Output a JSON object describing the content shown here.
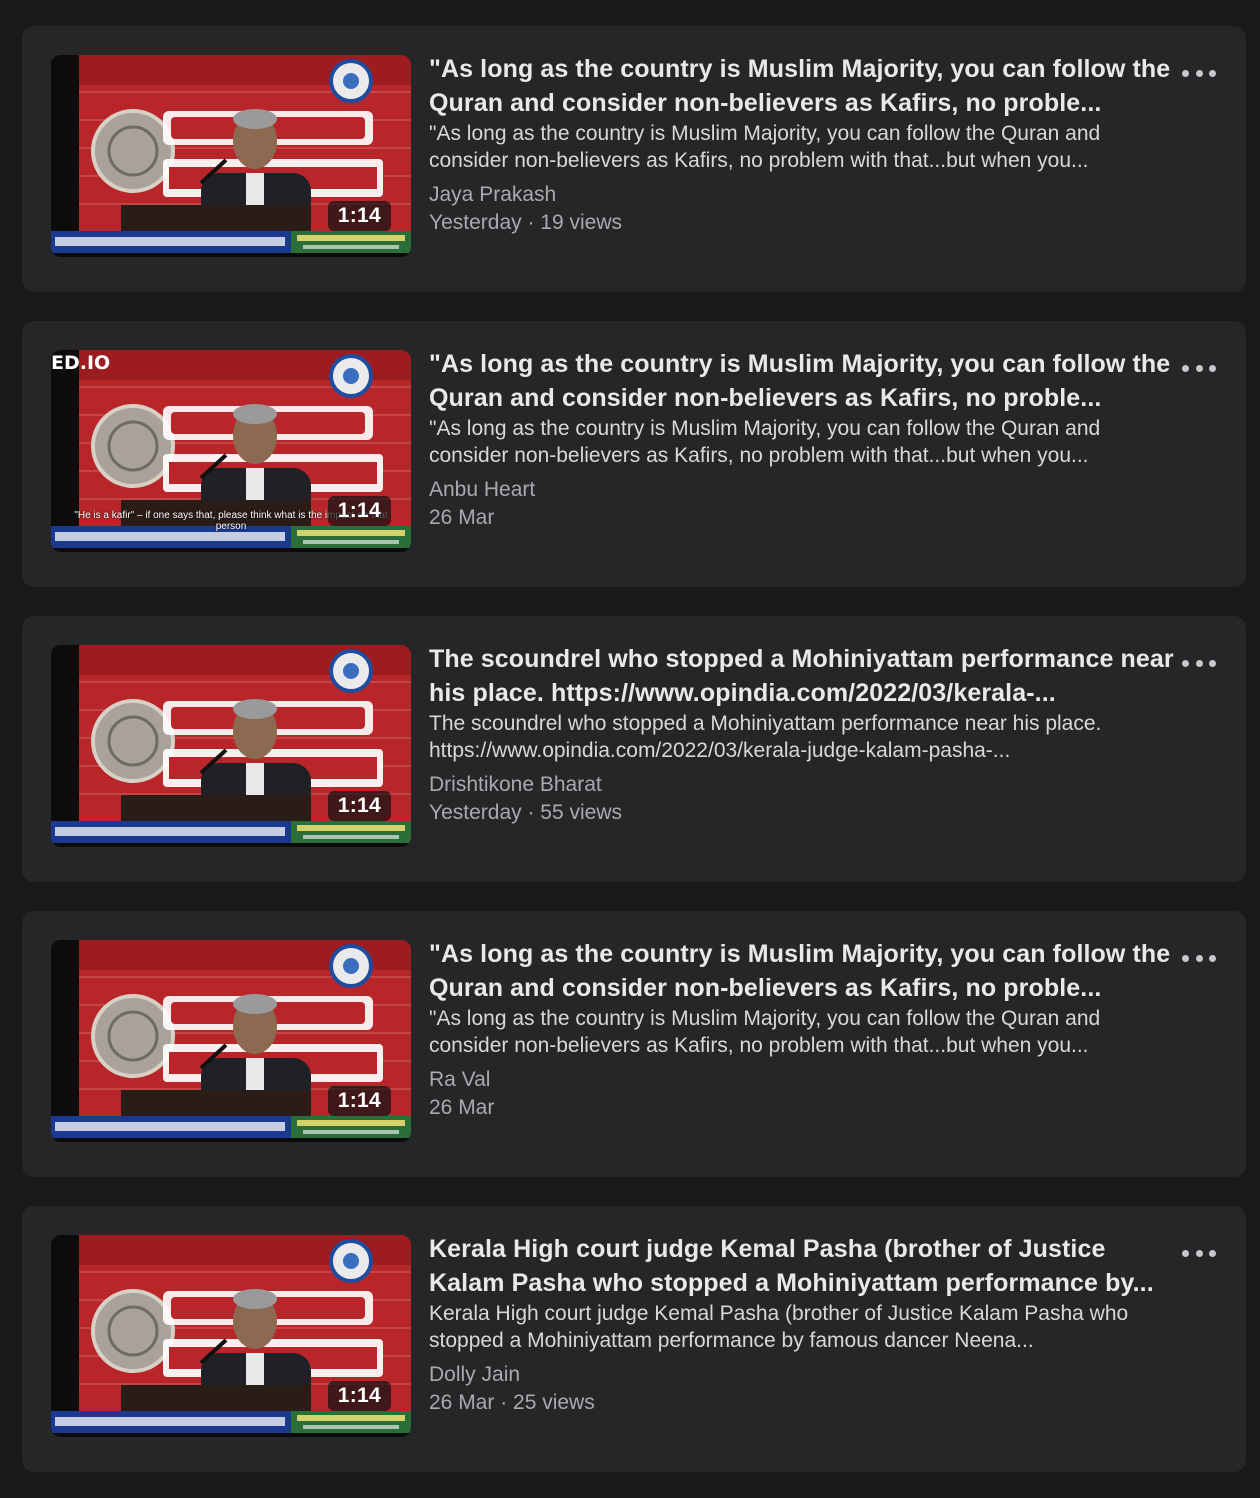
{
  "feed": {
    "items": [
      {
        "title": "\"As long as the country is Muslim Majority, you can follow the Quran and consider non-believers as Kafirs, no proble...",
        "description": "\"As long as the country is Muslim Majority, you can follow the Quran and consider non-believers as Kafirs, no problem with that...but when you...",
        "author": "Jaya Prakash",
        "meta": "Yesterday · 19 views",
        "duration": "1:14",
        "watermark": "",
        "caption": ""
      },
      {
        "title": "\"As long as the country is Muslim Majority, you can follow the Quran and consider non-believers as Kafirs, no proble...",
        "description": "\"As long as the country is Muslim Majority, you can follow the Quran and consider non-believers as Kafirs, no problem with that...but when you...",
        "author": "Anbu Heart",
        "meta": "26 Mar",
        "duration": "1:14",
        "watermark": "ED.IO",
        "caption": "\"He is a kafir\" – if one says that, please think what is the impact on that person"
      },
      {
        "title": "The scoundrel who stopped a Mohiniyattam performance near his place. https://www.opindia.com/2022/03/kerala-...",
        "description": "The scoundrel who stopped a Mohiniyattam performance near his place. https://www.opindia.com/2022/03/kerala-judge-kalam-pasha-...",
        "author": "Drishtikone Bharat",
        "meta": "Yesterday · 55 views",
        "duration": "1:14",
        "watermark": "",
        "caption": ""
      },
      {
        "title": "\"As long as the country is Muslim Majority, you can follow the Quran and consider non-believers as Kafirs, no proble...",
        "description": "\"As long as the country is Muslim Majority, you can follow the Quran and consider non-believers as Kafirs, no problem with that...but when you...",
        "author": "Ra Val",
        "meta": "26 Mar",
        "duration": "1:14",
        "watermark": "",
        "caption": ""
      },
      {
        "title": "Kerala High court judge Kemal Pasha (brother of Justice Kalam Pasha who stopped a Mohiniyattam performance by...",
        "description": "Kerala High court judge Kemal Pasha (brother of Justice Kalam Pasha who stopped a Mohiniyattam performance by famous dancer Neena...",
        "author": "Dolly Jain",
        "meta": "26 Mar · 25 views",
        "duration": "1:14",
        "watermark": "",
        "caption": ""
      }
    ]
  },
  "icons": {
    "more": "more-options-icon",
    "thumbnail": "video-thumbnail"
  },
  "colors": {
    "background": "#18191b",
    "card": "#252628",
    "title": "#e8e9eb",
    "secondary": "#a8aaad",
    "banner_red": "#b8262a",
    "banner_blue": "#1b3a8f"
  }
}
